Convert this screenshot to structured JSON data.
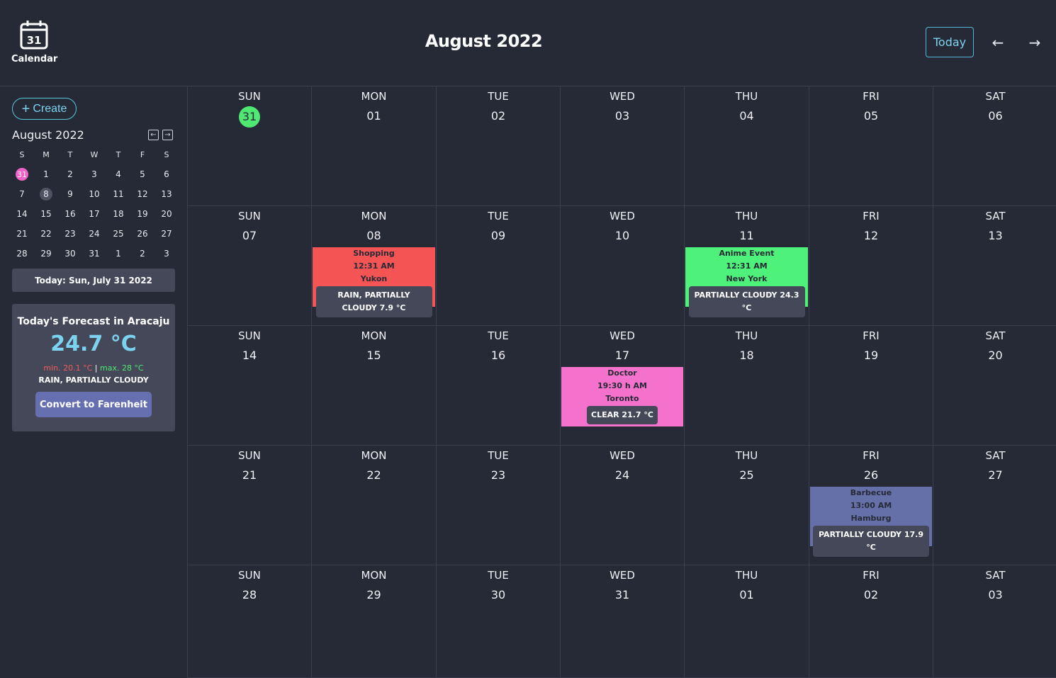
{
  "header": {
    "logo_number": "31",
    "logo_label": "Calendar",
    "month_title": "August 2022",
    "today_label": "Today",
    "prev_arrow": "←",
    "next_arrow": "→"
  },
  "sidebar": {
    "create_label": "Create",
    "create_icon": "+",
    "mini_title": "August 2022",
    "mini_weekdays": [
      "S",
      "M",
      "T",
      "W",
      "T",
      "F",
      "S"
    ],
    "mini_days": [
      [
        "31",
        "1",
        "2",
        "3",
        "4",
        "5",
        "6"
      ],
      [
        "7",
        "8",
        "9",
        "10",
        "11",
        "12",
        "13"
      ],
      [
        "14",
        "15",
        "16",
        "17",
        "18",
        "19",
        "20"
      ],
      [
        "21",
        "22",
        "23",
        "24",
        "25",
        "26",
        "27"
      ],
      [
        "28",
        "29",
        "30",
        "31",
        "1",
        "2",
        "3"
      ]
    ],
    "today_text": "Today: Sun, July 31 2022",
    "forecast": {
      "title": "Today's Forecast in Aracaju",
      "temp": "24.7 °C",
      "min": "min. 20.1 °C",
      "separator": " | ",
      "max": "max. 28 °C",
      "condition": "RAIN, PARTIALLY CLOUDY",
      "convert_label": "Convert to Farenheit"
    }
  },
  "calendar": {
    "weekdays": [
      "SUN",
      "MON",
      "TUE",
      "WED",
      "THU",
      "FRI",
      "SAT"
    ],
    "weeks": [
      [
        "31",
        "01",
        "02",
        "03",
        "04",
        "05",
        "06"
      ],
      [
        "07",
        "08",
        "09",
        "10",
        "11",
        "12",
        "13"
      ],
      [
        "14",
        "15",
        "16",
        "17",
        "18",
        "19",
        "20"
      ],
      [
        "21",
        "22",
        "23",
        "24",
        "25",
        "26",
        "27"
      ],
      [
        "28",
        "29",
        "30",
        "31",
        "01",
        "02",
        "03"
      ]
    ],
    "events": [
      {
        "week": 1,
        "day": 1,
        "name": "Shopping",
        "time": "12:31 AM",
        "location": "Yukon",
        "weather": "RAIN, PARTIALLY CLOUDY 7.9 °C",
        "color": "#f55454"
      },
      {
        "week": 1,
        "day": 4,
        "name": "Anime Event",
        "time": "12:31 AM",
        "location": "New York",
        "weather": "PARTIALLY CLOUDY 24.3 °C",
        "color": "#4ef27a"
      },
      {
        "week": 2,
        "day": 3,
        "name": "Doctor",
        "time": "19:30 h AM",
        "location": "Toronto",
        "weather": "CLEAR 21.7 °C",
        "color": "#f472cc"
      },
      {
        "week": 3,
        "day": 5,
        "name": "Barbecue",
        "time": "13:00 AM",
        "location": "Hamburg",
        "weather": "PARTIALLY CLOUDY 17.9 °C",
        "color": "#6670a8"
      }
    ]
  },
  "colors": {
    "background": "#262a36",
    "accent": "#7cd3f0",
    "current_day": "#4ee872",
    "today_mini": "#f062c8",
    "panel": "#444859"
  }
}
